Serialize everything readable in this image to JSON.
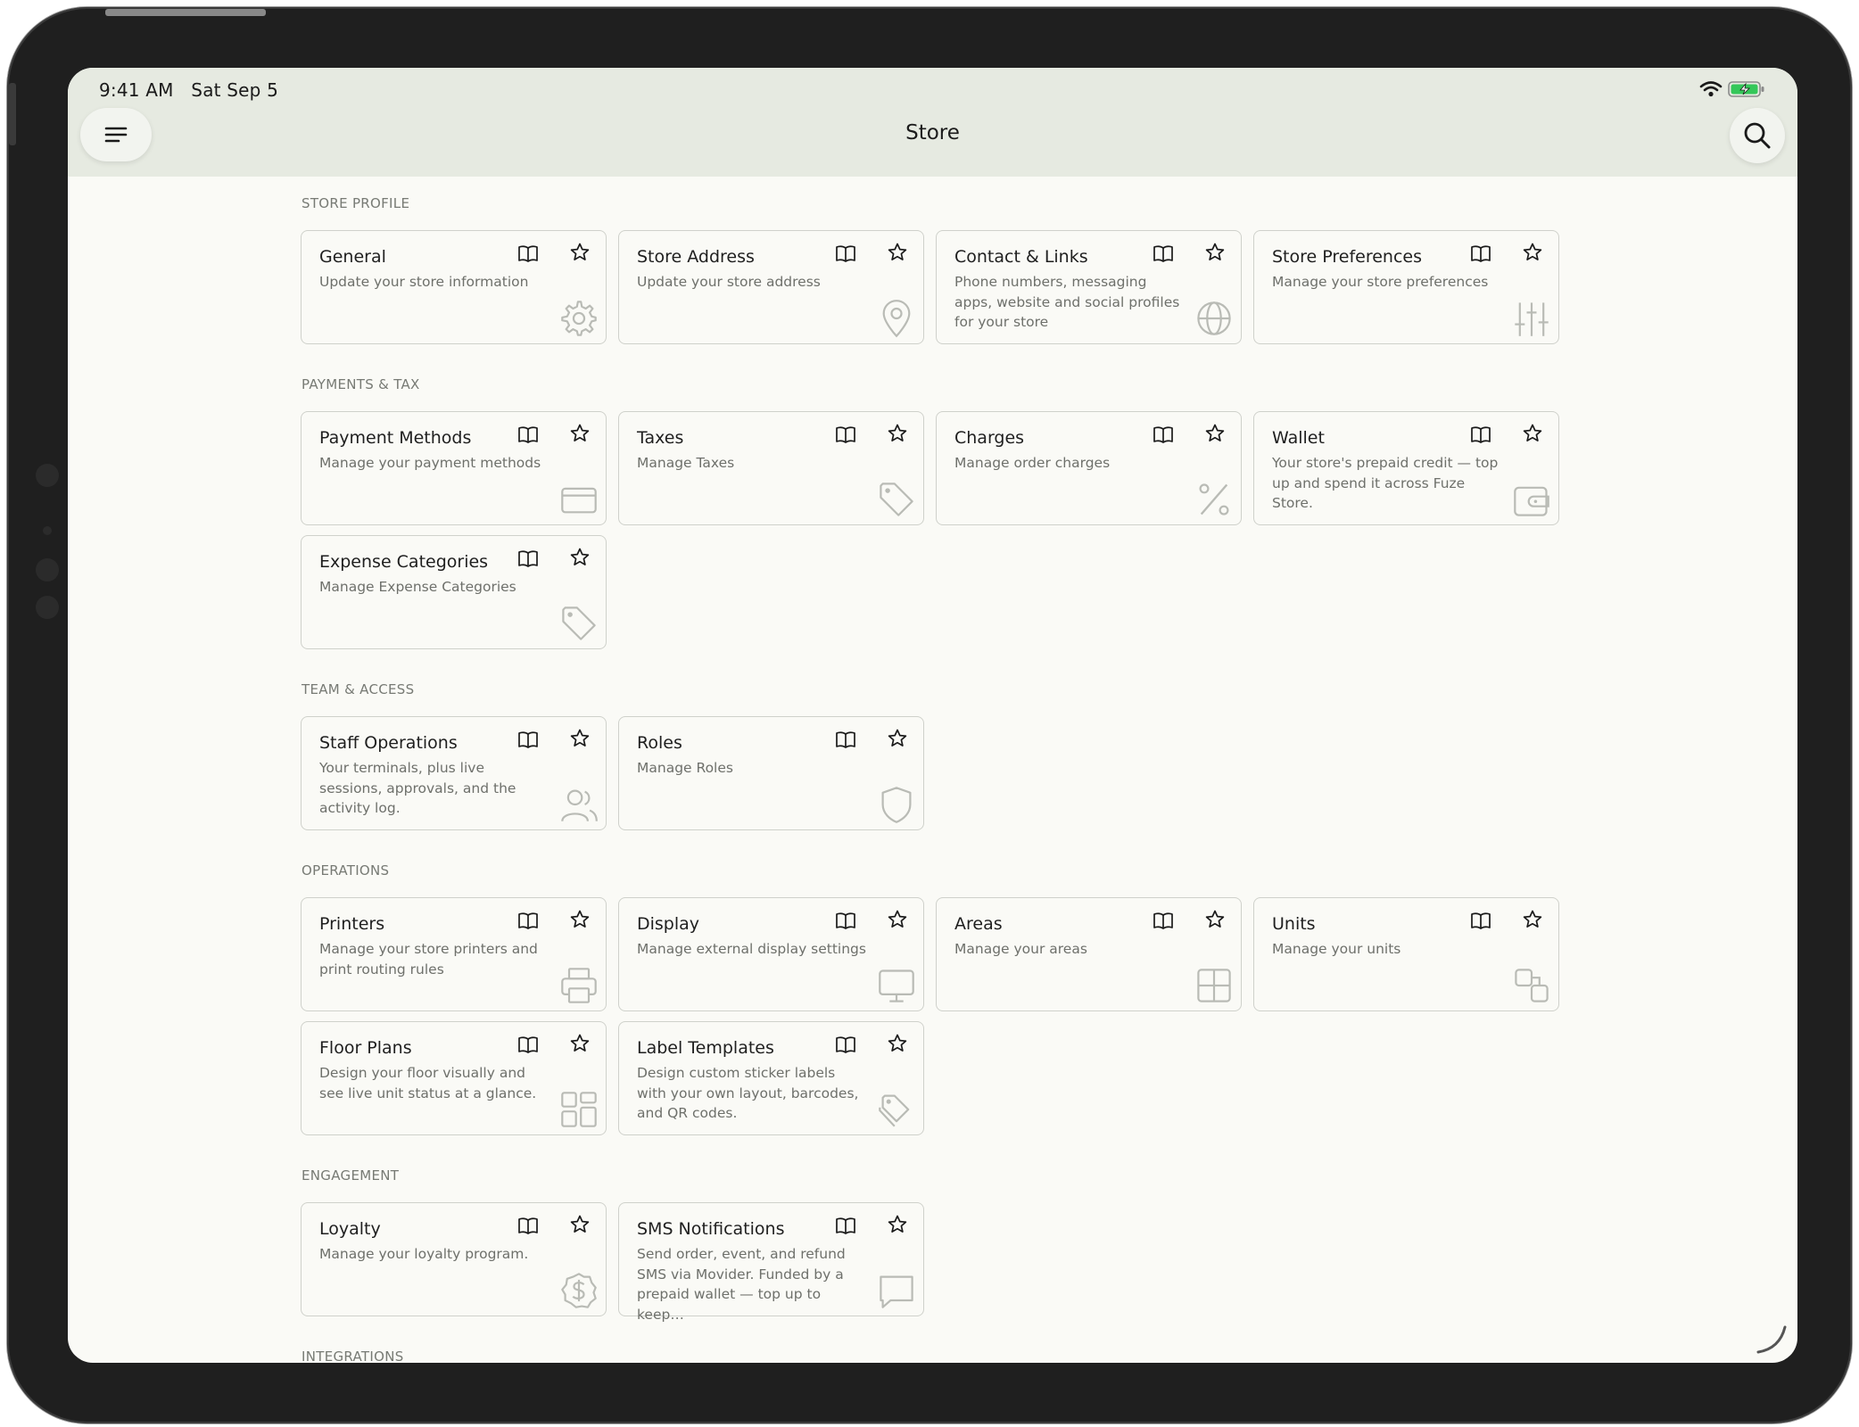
{
  "status_bar": {
    "time": "9:41 AM",
    "date": "Sat Sep 5"
  },
  "nav": {
    "title": "Store",
    "menu_icon": "menu-icon",
    "search_icon": "search-icon"
  },
  "sections": [
    {
      "label": "STORE PROFILE",
      "cards": [
        {
          "title": "General",
          "description": "Update your store information",
          "icon": "gear-icon"
        },
        {
          "title": "Store Address",
          "description": "Update your store address",
          "icon": "location-pin-icon"
        },
        {
          "title": "Contact & Links",
          "description": "Phone numbers, messaging apps, website and social profiles for your store",
          "icon": "globe-icon"
        },
        {
          "title": "Store Preferences",
          "description": "Manage your store preferences",
          "icon": "sliders-icon"
        }
      ]
    },
    {
      "label": "PAYMENTS & TAX",
      "cards": [
        {
          "title": "Payment Methods",
          "description": "Manage your payment methods",
          "icon": "credit-card-icon"
        },
        {
          "title": "Taxes",
          "description": "Manage Taxes",
          "icon": "tag-icon"
        },
        {
          "title": "Charges",
          "description": "Manage order charges",
          "icon": "percent-icon"
        },
        {
          "title": "Wallet",
          "description": "Your store's prepaid credit — top up and spend it across Fuze Store.",
          "icon": "wallet-icon"
        },
        {
          "title": "Expense Categories",
          "description": "Manage Expense Categories",
          "icon": "tag-icon"
        }
      ]
    },
    {
      "label": "TEAM & ACCESS",
      "cards": [
        {
          "title": "Staff Operations",
          "description": "Your terminals, plus live sessions, approvals, and the activity log.",
          "icon": "users-icon"
        },
        {
          "title": "Roles",
          "description": "Manage Roles",
          "icon": "shield-icon"
        }
      ]
    },
    {
      "label": "OPERATIONS",
      "cards": [
        {
          "title": "Printers",
          "description": "Manage your store printers and print routing rules",
          "icon": "printer-icon"
        },
        {
          "title": "Display",
          "description": "Manage external display settings",
          "icon": "monitor-icon"
        },
        {
          "title": "Areas",
          "description": "Manage your areas",
          "icon": "grid-icon"
        },
        {
          "title": "Units",
          "description": "Manage your units",
          "icon": "shapes-icon"
        },
        {
          "title": "Floor Plans",
          "description": "Design your floor visually and see live unit status at a glance.",
          "icon": "layout-icon"
        },
        {
          "title": "Label Templates",
          "description": "Design custom sticker labels with your own layout, barcodes, and QR codes.",
          "icon": "tags-icon"
        }
      ]
    },
    {
      "label": "ENGAGEMENT",
      "cards": [
        {
          "title": "Loyalty",
          "description": "Manage your loyalty program.",
          "icon": "dollar-badge-icon"
        },
        {
          "title": "SMS Notifications",
          "description": "Send order, event, and refund SMS via Movider. Funded by a prepaid wallet — top up to keep…",
          "icon": "message-icon"
        }
      ]
    },
    {
      "label": "INTEGRATIONS",
      "cards": []
    }
  ],
  "colors": {
    "nav_bg": "#e6eae1",
    "page_bg": "#fafaf6",
    "card_border": "#cfd1cb",
    "battery": "#34c759"
  }
}
